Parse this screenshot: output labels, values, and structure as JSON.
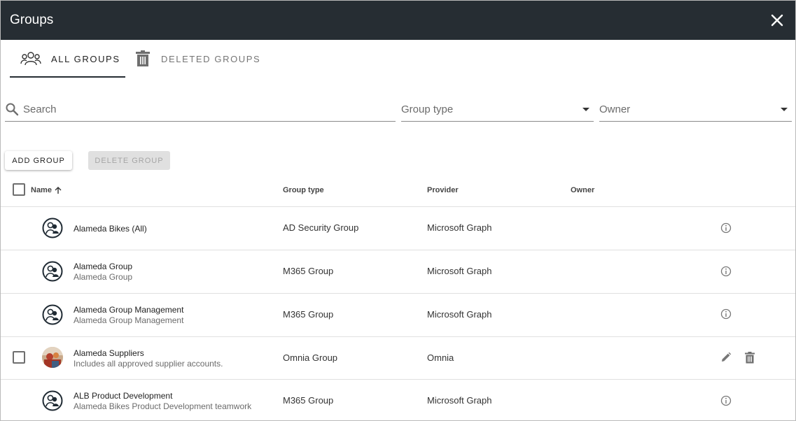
{
  "dialog": {
    "title": "Groups",
    "close_icon": "close-icon"
  },
  "tabs": [
    {
      "label": "ALL GROUPS",
      "icon": "people-icon",
      "active": true
    },
    {
      "label": "DELETED GROUPS",
      "icon": "trash-icon",
      "active": false
    }
  ],
  "filters": {
    "search_placeholder": "Search",
    "group_type_label": "Group type",
    "owner_label": "Owner"
  },
  "actions": {
    "add_group": "ADD GROUP",
    "delete_group": "DELETE GROUP"
  },
  "table": {
    "columns": {
      "name": "Name",
      "group_type": "Group type",
      "provider": "Provider",
      "owner": "Owner"
    },
    "sort": "ascending",
    "rows": [
      {
        "name": "Alameda Bikes (All)",
        "description": "",
        "group_type": "AD Security Group",
        "provider": "Microsoft Graph",
        "owner": "",
        "selectable": false,
        "avatar": "group-icon",
        "actions": [
          "info-icon"
        ]
      },
      {
        "name": "Alameda Group",
        "description": "Alameda Group",
        "group_type": "M365 Group",
        "provider": "Microsoft Graph",
        "owner": "",
        "selectable": false,
        "avatar": "group-icon",
        "actions": [
          "info-icon"
        ]
      },
      {
        "name": "Alameda Group Management",
        "description": "Alameda Group Management",
        "group_type": "M365 Group",
        "provider": "Microsoft Graph",
        "owner": "",
        "selectable": false,
        "avatar": "group-icon",
        "actions": [
          "info-icon"
        ]
      },
      {
        "name": "Alameda Suppliers",
        "description": "Includes all approved supplier accounts.",
        "group_type": "Omnia Group",
        "provider": "Omnia",
        "owner": "",
        "selectable": true,
        "avatar": "group-photo",
        "actions": [
          "edit-icon",
          "delete-icon"
        ]
      },
      {
        "name": "ALB Product Development",
        "description": "Alameda Bikes Product Development teamwork",
        "group_type": "M365 Group",
        "provider": "Microsoft Graph",
        "owner": "",
        "selectable": false,
        "avatar": "group-icon",
        "actions": [
          "info-icon"
        ]
      }
    ]
  },
  "colors": {
    "titlebar": "#262d33",
    "text": "#222222",
    "muted": "#6b6b6b",
    "divider": "#e0e0e0"
  }
}
